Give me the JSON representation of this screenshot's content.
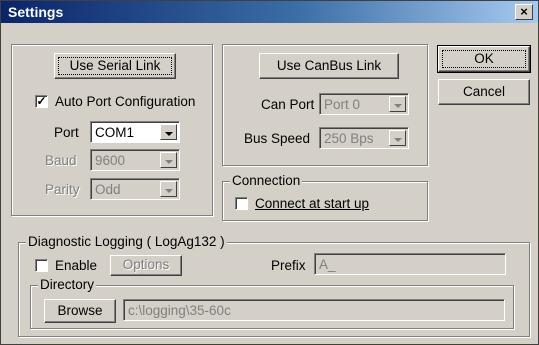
{
  "window": {
    "title": "Settings",
    "close_glyph": "×"
  },
  "serial": {
    "use_label": "Use Serial Link",
    "auto_port_label": "Auto Port Configuration",
    "auto_port_checked": true,
    "port_label": "Port",
    "port_value": "COM1",
    "baud_label": "Baud",
    "baud_value": "9600",
    "parity_label": "Parity",
    "parity_value": "Odd"
  },
  "canbus": {
    "use_label": "Use CanBus Link",
    "can_port_label": "Can Port",
    "can_port_value": "Port 0",
    "bus_speed_label": "Bus Speed",
    "bus_speed_value": "250 Bps"
  },
  "connection": {
    "legend": "Connection",
    "connect_label": "Connect at start up",
    "connect_checked": false
  },
  "buttons": {
    "ok": "OK",
    "cancel": "Cancel"
  },
  "logging": {
    "legend": "Diagnostic Logging ( LogAg132 )",
    "enable_label": "Enable",
    "enable_checked": false,
    "options_label": "Options",
    "prefix_label": "Prefix",
    "prefix_value": "A_",
    "directory_legend": "Directory",
    "browse_label": "Browse",
    "directory_value": "c:\\logging\\35-60c"
  },
  "icons": {
    "check": "check-mark-icon",
    "dropdown": "chevron-down-icon"
  }
}
